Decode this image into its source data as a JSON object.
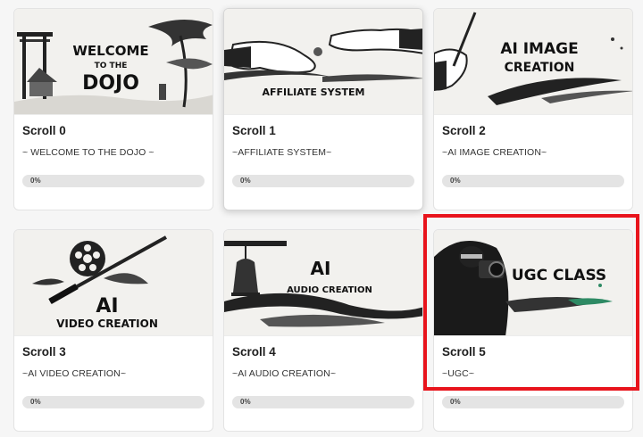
{
  "cards": [
    {
      "title": "Scroll 0",
      "subtitle": "~ WELCOME TO THE DOJO ~",
      "progress_label": "0%",
      "progress": 0,
      "art_line1": "WELCOME",
      "art_line2": "TO THE",
      "art_line3": "DOJO"
    },
    {
      "title": "Scroll 1",
      "subtitle": "~AFFILIATE SYSTEM~",
      "progress_label": "0%",
      "progress": 0,
      "art_line1": "AFFILIATE SYSTEM"
    },
    {
      "title": "Scroll 2",
      "subtitle": "~AI IMAGE CREATION~",
      "progress_label": "0%",
      "progress": 0,
      "art_line1": "AI IMAGE",
      "art_line2": "CREATION"
    },
    {
      "title": "Scroll 3",
      "subtitle": "~AI VIDEO CREATION~",
      "progress_label": "0%",
      "progress": 0,
      "art_line1": "AI",
      "art_line2": "VIDEO CREATION"
    },
    {
      "title": "Scroll 4",
      "subtitle": "~AI AUDIO CREATION~",
      "progress_label": "0%",
      "progress": 0,
      "art_line1": "AI",
      "art_line2": "AUDIO CREATION"
    },
    {
      "title": "Scroll 5",
      "subtitle": "~UGC~",
      "progress_label": "0%",
      "progress": 0,
      "art_line1": "UGC CLASS"
    }
  ],
  "colors": {
    "highlight": "#e8141c",
    "progress_track": "#e4e4e4",
    "card_bg": "#ffffff"
  }
}
